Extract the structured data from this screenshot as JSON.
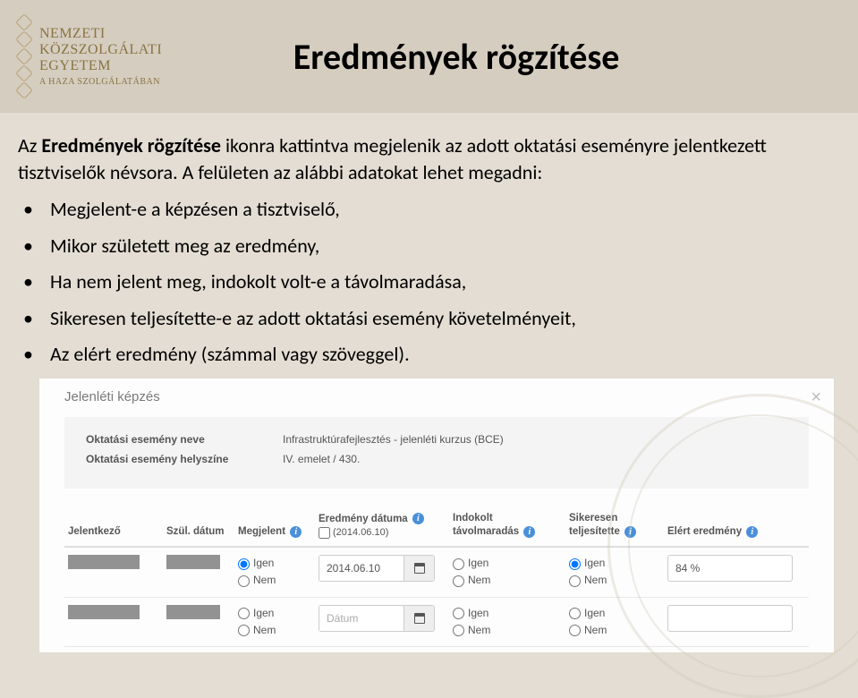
{
  "header": {
    "logo": {
      "line1": "NEMZETI",
      "line2": "KÖZSZOLGÁLATI",
      "line3": "EGYETEM",
      "line4": "A HAZA SZOLGÁLATÁBAN"
    },
    "title": "Eredmények rögzítése"
  },
  "intro": {
    "prefix": "Az ",
    "bold": "Eredmények rögzítése",
    "rest": " ikonra kattintva megjelenik az adott oktatási eseményre jelentkezett tisztviselők névsora. A felületen az alábbi adatokat lehet megadni:"
  },
  "bullets": [
    "Megjelent-e a képzésen a tisztviselő,",
    "Mikor született meg az eredmény,",
    "Ha nem jelent meg, indokolt volt-e a távolmaradása,",
    "Sikeresen teljesítette-e az adott oktatási esemény követelményeit,",
    "Az elért eredmény (számmal vagy szöveggel)."
  ],
  "panel": {
    "title": "Jelenléti képzés",
    "event_name_label": "Oktatási esemény neve",
    "event_name_value": "Infrastruktúrafejlesztés - jelenléti kurzus (BCE)",
    "event_loc_label": "Oktatási esemény helyszíne",
    "event_loc_value": "IV. emelet / 430.",
    "headers": {
      "applicant": "Jelentkező",
      "birth": "Szül. dátum",
      "attended": "Megjelent",
      "result_date": "Eredmény dátuma",
      "result_date_sub": "(2014.06.10)",
      "justified": "Indokolt távolmaradás",
      "passed": "Sikeresen teljesítette",
      "achieved": "Elért eredmény"
    },
    "options": {
      "yes": "Igen",
      "no": "Nem"
    },
    "rows": [
      {
        "attended": "Igen",
        "date": "2014.06.10",
        "justified": "",
        "passed": "Igen",
        "result": "84 %"
      },
      {
        "attended": "",
        "date": "",
        "date_placeholder": "Dátum",
        "justified": "",
        "passed": "",
        "result": ""
      }
    ]
  }
}
